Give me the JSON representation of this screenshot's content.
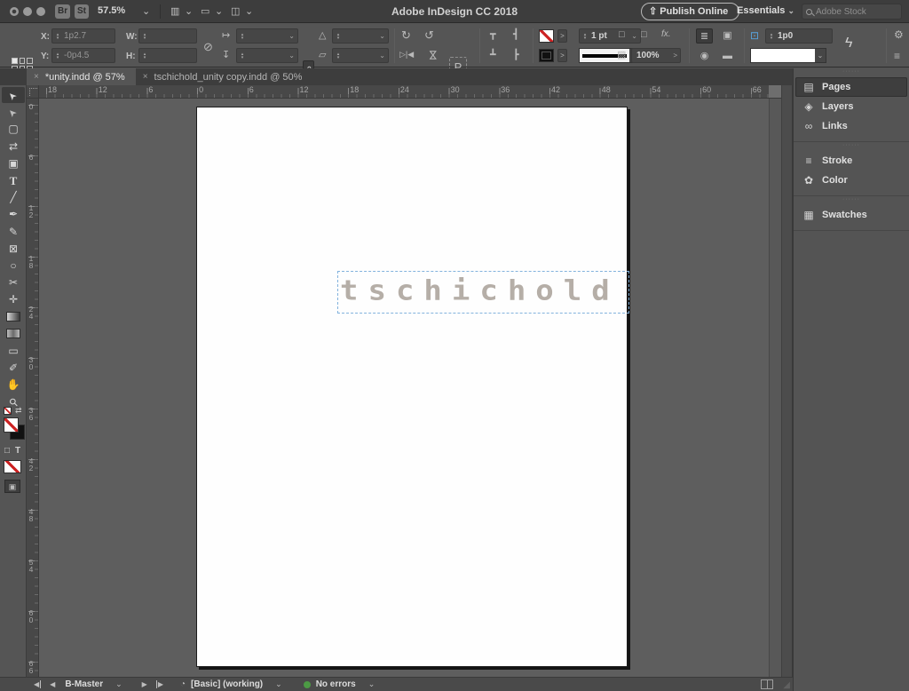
{
  "titlebar": {
    "app_title": "Adobe InDesign CC 2018",
    "bridge_button": "Br",
    "stock_button": "St",
    "zoom_level": "57.5%",
    "publish_button": "Publish Online",
    "workspace": "Essentials",
    "search_placeholder": "Adobe Stock"
  },
  "icons": {
    "chevron": "⌄",
    "up": "▴",
    "down": "▾",
    "flyout": ">",
    "upload": "⇧",
    "link_broken": "⊘",
    "scale_x": "↦",
    "scale_y": "↧",
    "constrain": "∞",
    "angle": "△",
    "shear": "▱",
    "rotate_cw": "↻",
    "rotate_ccw": "↺",
    "flip_h": "▷|◀",
    "flip_v": "⋈",
    "p_marker": "P",
    "align_top": "┳",
    "align_left": "┣",
    "align_bottom": "┻",
    "align_right": "┫",
    "corner_option": "□",
    "fx": "fx.",
    "opacity_icon": "▨",
    "wrap_none": "≣",
    "wrap_bound": "▣",
    "wrap_jump": "◉",
    "wrap_bar": "▬",
    "frame_fit": "⊡",
    "zap": "ϟ",
    "gear": "⚙",
    "menu": "≡",
    "swap": "⇄",
    "container_box": "□",
    "container_text": "T",
    "apply_image": "▣",
    "gauge": "◔",
    "nav_prev": "◀",
    "nav_next": "▶",
    "grip": "◢"
  },
  "control_panel": {
    "x_label": "X:",
    "x_value": "1p2.7",
    "y_label": "Y:",
    "y_value": "-0p4.5",
    "w_label": "W:",
    "h_label": "H:",
    "stroke_weight": "1 pt",
    "opacity": "100%",
    "corner_radius": "1p0"
  },
  "tabs": [
    {
      "name": "tab-unity",
      "label": "*unity.indd @ 57%",
      "close": "×",
      "active": true
    },
    {
      "name": "tab-tschichold-copy",
      "label": "tschichold_unity copy.indd @ 50%",
      "close": "×",
      "active": false
    }
  ],
  "toolbar": {
    "tools": [
      {
        "name": "selection-tool",
        "glyph": "➤",
        "active": true
      },
      {
        "name": "direct-selection-tool",
        "glyph": "➤"
      },
      {
        "name": "page-tool",
        "glyph": "▢"
      },
      {
        "name": "gap-tool",
        "glyph": "⇄"
      },
      {
        "name": "content-collector-tool",
        "glyph": "▣"
      },
      {
        "name": "type-tool",
        "glyph": "T"
      },
      {
        "name": "line-tool",
        "glyph": "╱"
      },
      {
        "name": "pen-tool",
        "glyph": "✒"
      },
      {
        "name": "pencil-tool",
        "glyph": "✎"
      },
      {
        "name": "rectangle-frame-tool",
        "glyph": "⊠"
      },
      {
        "name": "ellipse-tool",
        "glyph": "○"
      },
      {
        "name": "scissors-tool",
        "glyph": "✂"
      },
      {
        "name": "free-transform-tool",
        "glyph": "✛"
      },
      {
        "name": "gradient-tool",
        "glyph": ""
      },
      {
        "name": "gradient-feather-tool",
        "glyph": ""
      },
      {
        "name": "note-tool",
        "glyph": "▭"
      },
      {
        "name": "color-theme-tool",
        "glyph": "✐"
      },
      {
        "name": "hand-tool",
        "glyph": "✋"
      },
      {
        "name": "zoom-tool",
        "glyph": "⚲"
      }
    ]
  },
  "rulers": {
    "horizontal": [
      "18",
      "12",
      "6",
      "0",
      "6",
      "12",
      "18",
      "24",
      "30",
      "36",
      "42",
      "48",
      "54",
      "60",
      "66"
    ],
    "vertical": [
      "0",
      "6",
      "12",
      "18",
      "24",
      "30",
      "36",
      "42",
      "48",
      "54",
      "60",
      "66"
    ]
  },
  "canvas": {
    "page_text": "tschichold",
    "text_color": "#b5aea7"
  },
  "dock": {
    "group1": [
      {
        "name": "panel-pages",
        "label": "Pages",
        "glyph": "▤",
        "active": true
      },
      {
        "name": "panel-layers",
        "label": "Layers",
        "glyph": "◈"
      },
      {
        "name": "panel-links",
        "label": "Links",
        "glyph": "∞"
      }
    ],
    "group2": [
      {
        "name": "panel-stroke",
        "label": "Stroke",
        "glyph": "≡"
      },
      {
        "name": "panel-color",
        "label": "Color",
        "glyph": "✿"
      }
    ],
    "group3": [
      {
        "name": "panel-swatches",
        "label": "Swatches",
        "glyph": "▦"
      }
    ],
    "handle_dots": "······"
  },
  "statusbar": {
    "master": "B-Master",
    "preset": "[Basic] (working)",
    "errors": "No errors",
    "error_color": "#4c9a44"
  }
}
